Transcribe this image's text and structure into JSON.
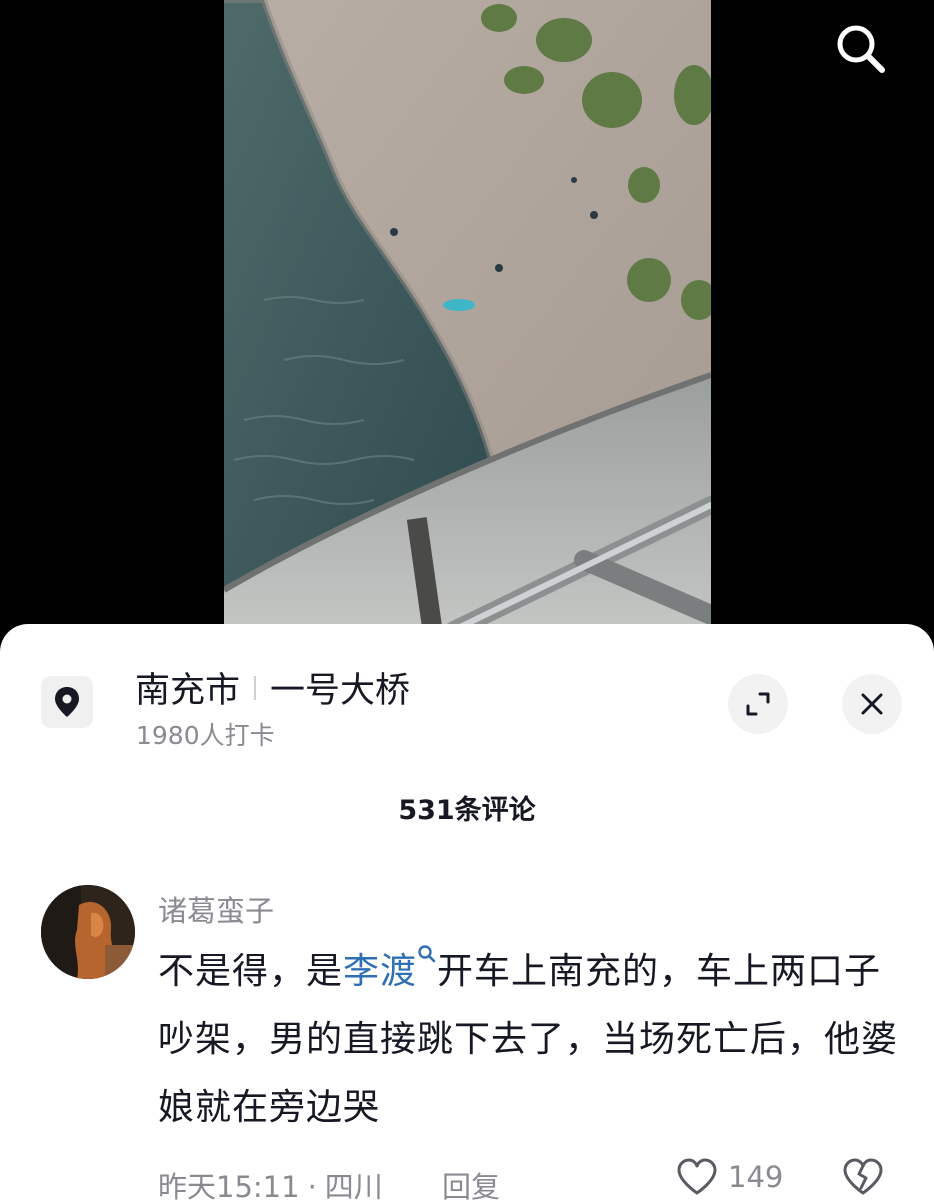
{
  "location": {
    "city": "南充市",
    "place": "一号大桥",
    "checkins": "1980人打卡"
  },
  "comments_header": {
    "count_label": "531条评论"
  },
  "comment": {
    "author": "诸葛蛮子",
    "text_before_mention": "不是得，是",
    "mention": "李渡",
    "text_after_mention": "开车上南充的，车上两口子吵架，男的直接跳下去了，当场死亡后，他婆娘就在旁边哭",
    "time": "昨天15:11",
    "region": "四川",
    "reply_label": "回复",
    "like_count": "149"
  },
  "icons": {
    "search": "search-icon",
    "location": "location-pin-icon",
    "expand": "expand-icon",
    "close": "close-icon",
    "like": "heart-icon",
    "dislike": "broken-heart-icon"
  },
  "colors": {
    "background": "#000000",
    "sheet": "#ffffff",
    "primary_text": "#161823",
    "secondary_text": "#8a8b91",
    "mention": "#2f6fb3"
  }
}
